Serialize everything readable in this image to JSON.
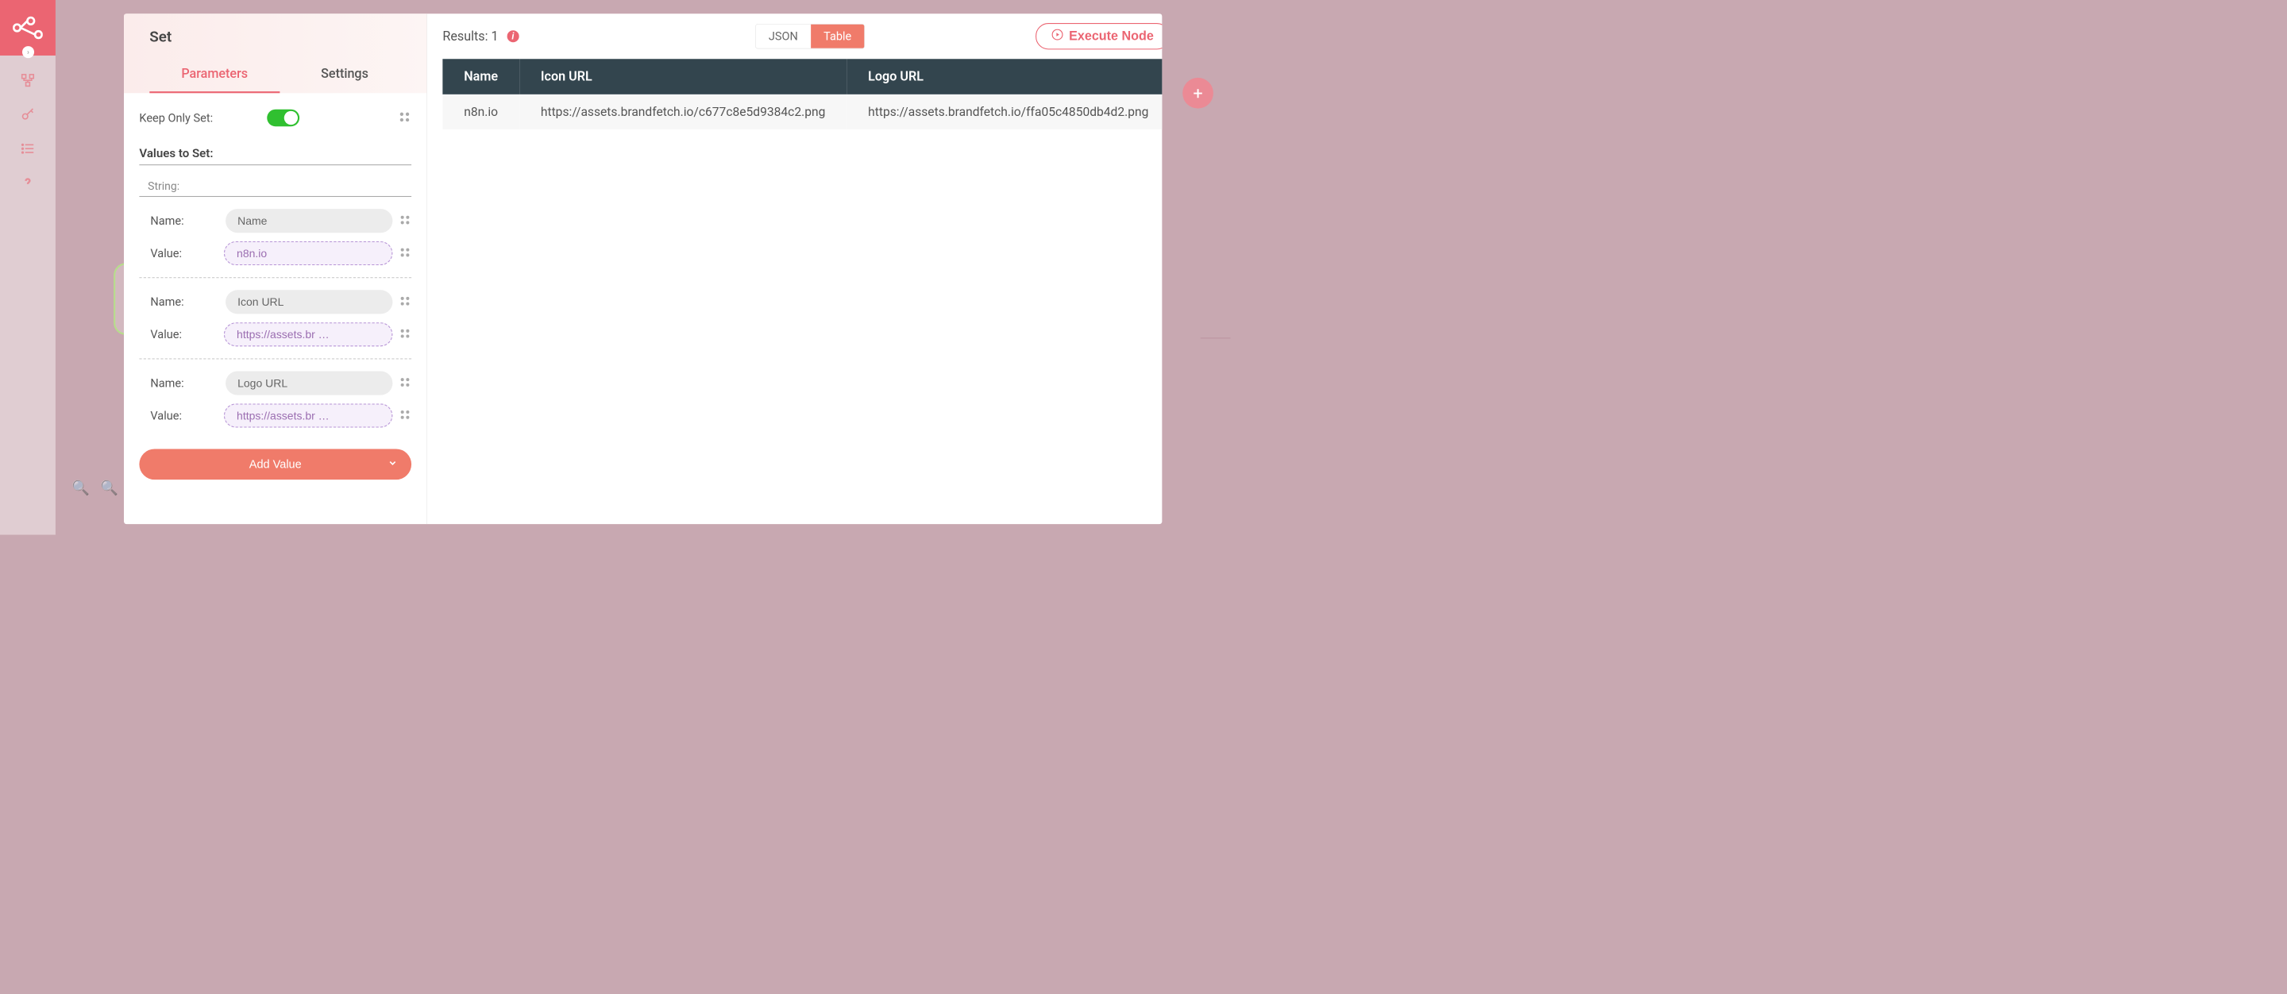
{
  "node": {
    "title": "Set",
    "tabs": {
      "parameters": "Parameters",
      "settings": "Settings"
    },
    "keepOnlySet": {
      "label": "Keep Only Set:",
      "value": true
    },
    "valuesSection": "Values to Set:",
    "stringLabel": "String:",
    "rows": [
      {
        "nameLabel": "Name:",
        "nameValue": "Name",
        "valueLabel": "Value:",
        "valueValue": "n8n.io",
        "expr": true
      },
      {
        "nameLabel": "Name:",
        "nameValue": "Icon URL",
        "valueLabel": "Value:",
        "valueValue": "https://assets.br …",
        "expr": true
      },
      {
        "nameLabel": "Name:",
        "nameValue": "Logo URL",
        "valueLabel": "Value:",
        "valueValue": "https://assets.br …",
        "expr": true
      }
    ],
    "addValue": "Add Value"
  },
  "results": {
    "label": "Results: 1",
    "viewJson": "JSON",
    "viewTable": "Table",
    "execute": "Execute Node",
    "columns": [
      "Name",
      "Icon URL",
      "Logo URL"
    ],
    "data": [
      [
        "n8n.io",
        "https://assets.brandfetch.io/c677c8e5d9384c2.png",
        "https://assets.brandfetch.io/ffa05c4850db4d2.png"
      ]
    ]
  }
}
